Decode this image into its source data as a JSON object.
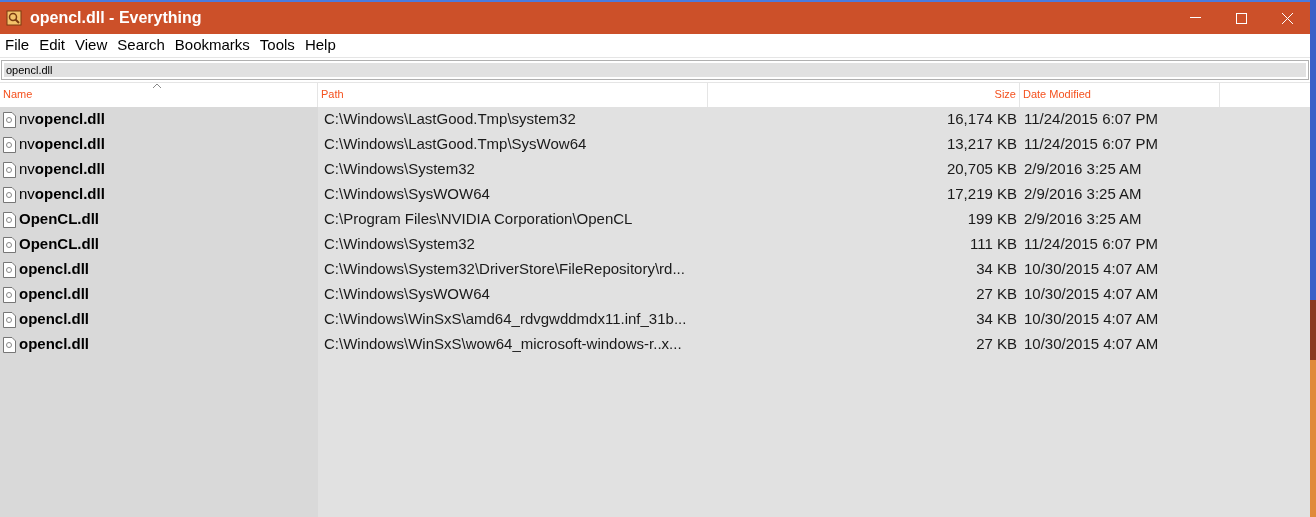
{
  "window": {
    "title": "opencl.dll - Everything"
  },
  "menu": [
    "File",
    "Edit",
    "View",
    "Search",
    "Bookmarks",
    "Tools",
    "Help"
  ],
  "search": {
    "value": "opencl.dll"
  },
  "columns": [
    {
      "label": "Name",
      "sorted": true
    },
    {
      "label": "Path",
      "sorted": false
    },
    {
      "label": "Size",
      "sorted": false
    },
    {
      "label": "Date Modified",
      "sorted": false
    }
  ],
  "rows": [
    {
      "name": "nv**opencl.dll**",
      "path": "C:\\Windows\\LastGood.Tmp\\system32",
      "size": "16,174 KB",
      "date": "11/24/2015 6:07 PM"
    },
    {
      "name": "nv**opencl.dll**",
      "path": "C:\\Windows\\LastGood.Tmp\\SysWow64",
      "size": "13,217 KB",
      "date": "11/24/2015 6:07 PM"
    },
    {
      "name": "nv**opencl.dll**",
      "path": "C:\\Windows\\System32",
      "size": "20,705 KB",
      "date": "2/9/2016 3:25 AM"
    },
    {
      "name": "nv**opencl.dll**",
      "path": "C:\\Windows\\SysWOW64",
      "size": "17,219 KB",
      "date": "2/9/2016 3:25 AM"
    },
    {
      "name": "**OpenCL.dll**",
      "path": "C:\\Program Files\\NVIDIA Corporation\\OpenCL",
      "size": "199 KB",
      "date": "2/9/2016 3:25 AM"
    },
    {
      "name": "**OpenCL.dll**",
      "path": "C:\\Windows\\System32",
      "size": "111 KB",
      "date": "11/24/2015 6:07 PM"
    },
    {
      "name": "**opencl.dll**",
      "path": "C:\\Windows\\System32\\DriverStore\\FileRepository\\rd...",
      "size": "34 KB",
      "date": "10/30/2015 4:07 AM"
    },
    {
      "name": "**opencl.dll**",
      "path": "C:\\Windows\\SysWOW64",
      "size": "27 KB",
      "date": "10/30/2015 4:07 AM"
    },
    {
      "name": "**opencl.dll**",
      "path": "C:\\Windows\\WinSxS\\amd64_rdvgwddmdx11.inf_31b...",
      "size": "34 KB",
      "date": "10/30/2015 4:07 AM"
    },
    {
      "name": "**opencl.dll**",
      "path": "C:\\Windows\\WinSxS\\wow64_microsoft-windows-r..x...",
      "size": "27 KB",
      "date": "10/30/2015 4:07 AM"
    }
  ]
}
